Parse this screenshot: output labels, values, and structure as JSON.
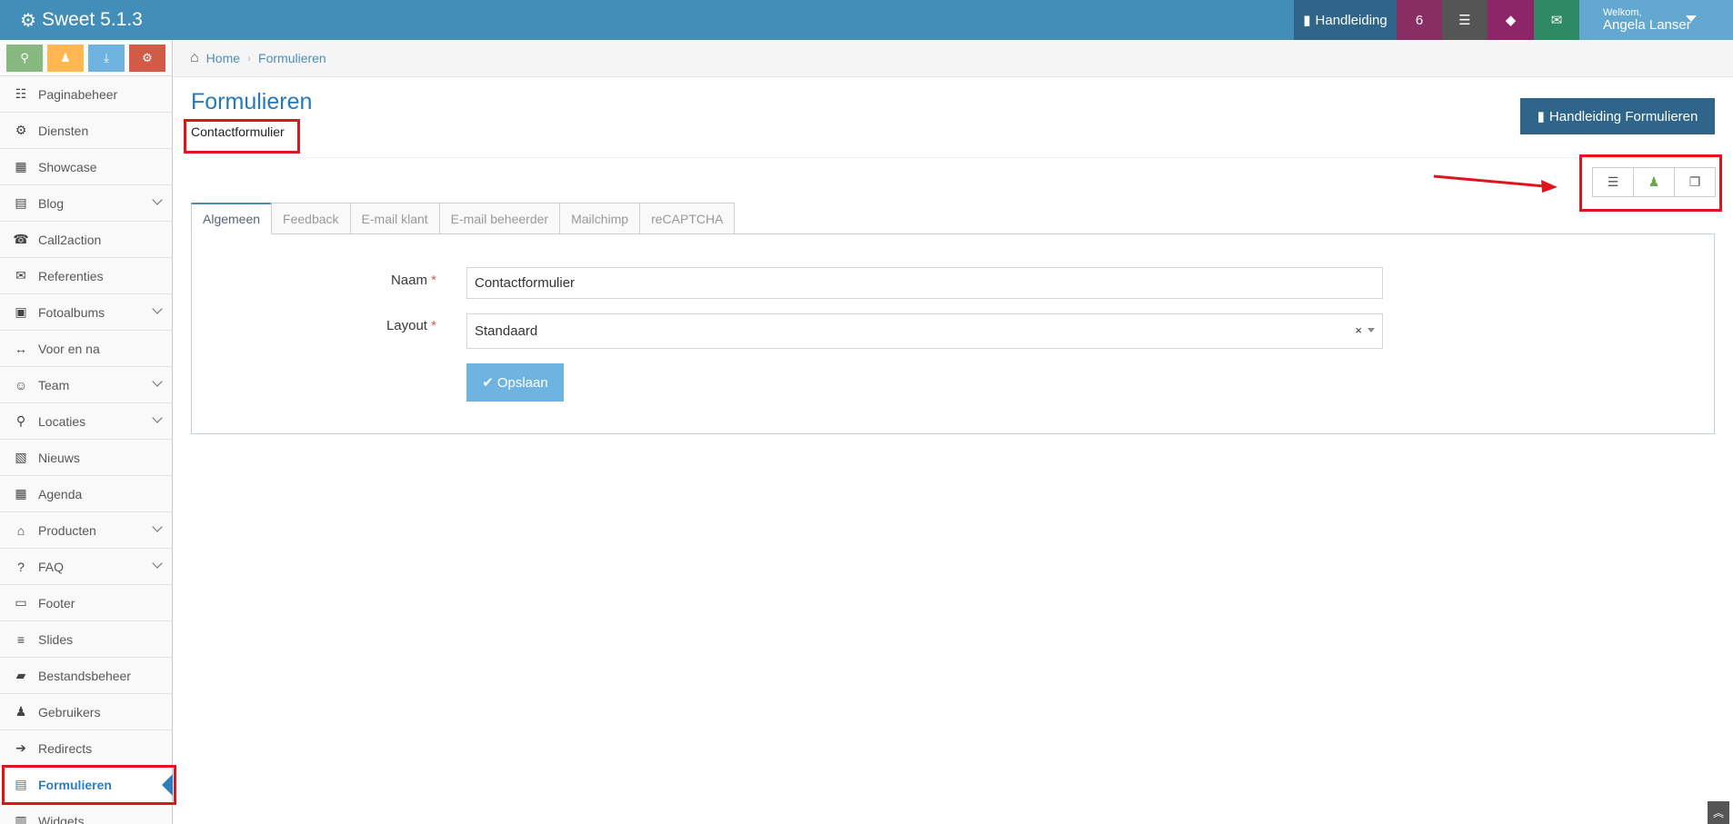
{
  "app": {
    "title": "Sweet 5.1.3"
  },
  "topbar": {
    "manual_label": "Handleiding",
    "notifications_count": "6",
    "user": {
      "welcome": "Welkom,",
      "name": "Angela Lanser"
    }
  },
  "sidebar": {
    "items": [
      {
        "label": "Paginabeheer",
        "icon": "☷"
      },
      {
        "label": "Diensten",
        "icon": "⚙"
      },
      {
        "label": "Showcase",
        "icon": "▦"
      },
      {
        "label": "Blog",
        "icon": "▤"
      },
      {
        "label": "Call2action",
        "icon": "☎"
      },
      {
        "label": "Referenties",
        "icon": "✉"
      },
      {
        "label": "Fotoalbums",
        "icon": "▣"
      },
      {
        "label": "Voor en na",
        "icon": "↔"
      },
      {
        "label": "Team",
        "icon": "☺"
      },
      {
        "label": "Locaties",
        "icon": "⚲"
      },
      {
        "label": "Nieuws",
        "icon": "▧"
      },
      {
        "label": "Agenda",
        "icon": "▦"
      },
      {
        "label": "Producten",
        "icon": "⌂"
      },
      {
        "label": "FAQ",
        "icon": "?"
      },
      {
        "label": "Footer",
        "icon": "▭"
      },
      {
        "label": "Slides",
        "icon": "≡"
      },
      {
        "label": "Bestandsbeheer",
        "icon": "▰"
      },
      {
        "label": "Gebruikers",
        "icon": "♟"
      },
      {
        "label": "Redirects",
        "icon": "➔"
      },
      {
        "label": "Formulieren",
        "icon": "▤"
      },
      {
        "label": "Widgets",
        "icon": "▥"
      }
    ]
  },
  "breadcrumb": {
    "home": "Home",
    "current": "Formulieren"
  },
  "page": {
    "title": "Formulieren",
    "subtitle": "Contactformulier",
    "manual_button": "Handleiding Formulieren"
  },
  "tabs": [
    "Algemeen",
    "Feedback",
    "E-mail klant",
    "E-mail beheerder",
    "Mailchimp",
    "reCAPTCHA"
  ],
  "form": {
    "name_label": "Naam",
    "name_value": "Contactformulier",
    "layout_label": "Layout",
    "layout_value": "Standaard",
    "required_mark": "*",
    "save_label": "Opslaan"
  },
  "colors": {
    "topbar": "#438eb9",
    "accent": "#2679b5",
    "highlight": "#e3131c",
    "save": "#6fb3e0"
  }
}
